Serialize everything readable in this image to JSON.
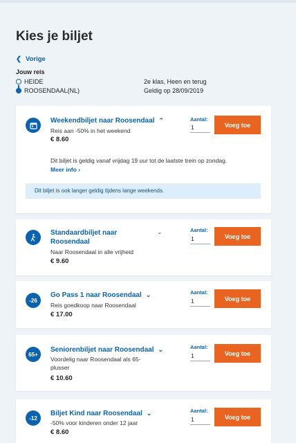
{
  "header": {
    "title": "Kies je biljet",
    "back_label": "Vorige"
  },
  "journey": {
    "label": "Jouw reis",
    "from": "HEIDE",
    "to": "ROOSENDAAL(NL)",
    "class_info": "2e klas, Heen en terug",
    "validity": "Geldig op 28/09/2019"
  },
  "labels": {
    "quantity": "Aantal:",
    "add_button": "Voeg toe"
  },
  "tickets": [
    {
      "icon_text": "",
      "icon": "calendar-icon",
      "name": "Weekendbiljet naar Roosendaal",
      "description": "Reis aan -50% in het weekend",
      "price": "€ 8.60",
      "quantity": "1",
      "expanded": true,
      "detail": "Dit biljet is geldig vanaf vrijdag 19 uur tot de laatste trein op zondag.",
      "more_info": "Meer info",
      "notice": "Dit biljet is ook langer geldig tijdens lange weekends."
    },
    {
      "icon_text": "",
      "icon": "walker-icon",
      "name_line1": "Standaardbiljet naar",
      "name_line2": "Roosendaal",
      "description": "Naar Roosendaal in alle vrijheid",
      "price": "€ 9.60",
      "quantity": "1"
    },
    {
      "icon_text": "-26",
      "name": "Go Pass 1 naar Roosendaal",
      "description": "Reis goedkoop naar Roosendaal",
      "price": "€ 17.00",
      "quantity": "1"
    },
    {
      "icon_text": "65+",
      "name": "Seniorenbiljet naar Roosendaal",
      "description_line1": "Voordelig naar Roosendaal als 65-",
      "description_line2": "plusser",
      "price": "€ 10.60",
      "quantity": "1"
    },
    {
      "icon_text": "-12",
      "name": "Biljet Kind naar Roosendaal",
      "description": "-50% voor kinderen onder 12 jaar",
      "price": "€ 8.60",
      "quantity": "1"
    }
  ]
}
